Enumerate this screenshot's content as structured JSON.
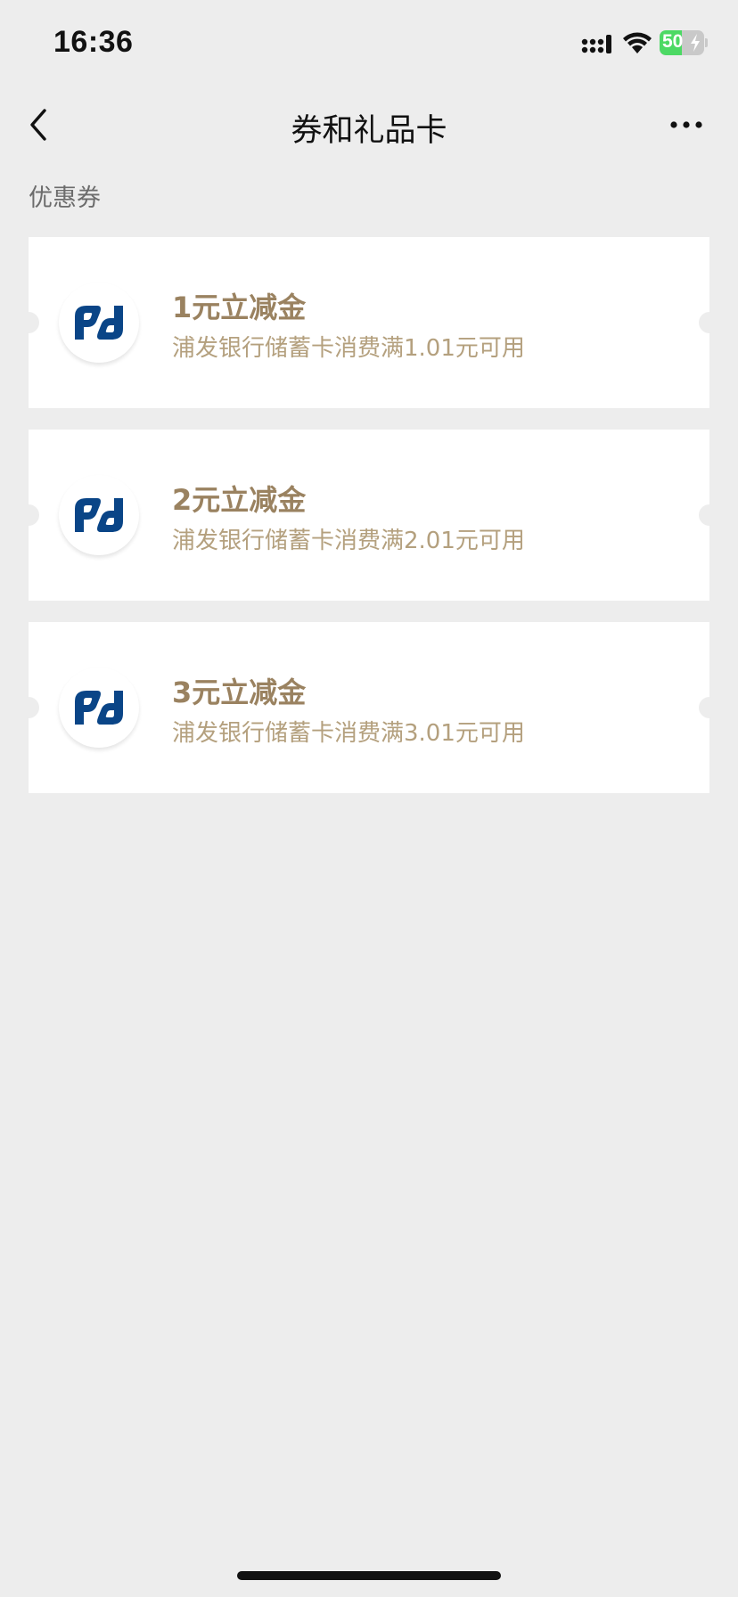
{
  "status_bar": {
    "time": "16:36",
    "battery_percent": 50,
    "battery_text": "50",
    "icons": [
      "signal-icon",
      "wifi-icon",
      "battery-icon",
      "charging-bolt-icon"
    ]
  },
  "nav": {
    "title": "券和礼品卡",
    "back_icon": "chevron-left-icon",
    "more_icon": "more-dots-icon"
  },
  "section": {
    "label": "优惠券"
  },
  "coupons": [
    {
      "title": "1元立减金",
      "description": "浦发银行储蓄卡消费满1.01元可用",
      "logo": "spdb-bank-logo-icon"
    },
    {
      "title": "2元立减金",
      "description": "浦发银行储蓄卡消费满2.01元可用",
      "logo": "spdb-bank-logo-icon"
    },
    {
      "title": "3元立减金",
      "description": "浦发银行储蓄卡消费满3.01元可用",
      "logo": "spdb-bank-logo-icon"
    }
  ],
  "colors": {
    "background": "#ededed",
    "card": "#ffffff",
    "coupon_title": "#9a8260",
    "coupon_desc": "#b4a07e",
    "bank_logo_blue": "#0a4587",
    "battery_green": "#4cd964"
  }
}
